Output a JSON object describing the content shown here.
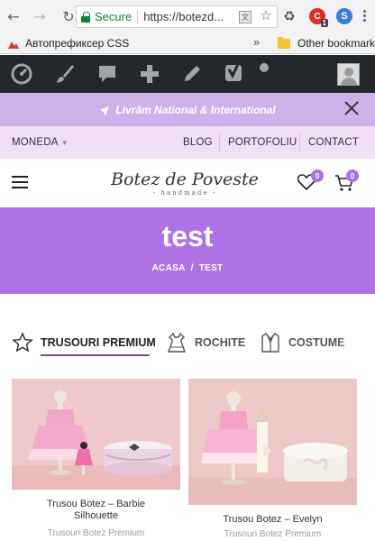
{
  "browser": {
    "secure_label": "Secure",
    "url": "https://botezd...",
    "bookmark_1": "Автопрефиксер CSS",
    "bookmark_more": "»",
    "other_bookmarks": "Other bookmarks",
    "extension_badge": "1"
  },
  "promo": {
    "text": "Livrăm National & International"
  },
  "topnav": {
    "currency": "MONEDA",
    "links": [
      "BLOG",
      "PORTOFOLIU",
      "CONTACT"
    ]
  },
  "header": {
    "logo_main": "Botez de Poveste",
    "logo_sub": "- handmade -",
    "wishlist_count": "0",
    "cart_count": "0"
  },
  "page": {
    "title": "test",
    "breadcrumb": [
      "ACASA",
      "/",
      "TEST"
    ]
  },
  "categories": [
    {
      "label": "TRUSOURI PREMIUM",
      "icon": "star-icon",
      "active": true
    },
    {
      "label": "ROCHITE",
      "icon": "dress-icon",
      "active": false
    },
    {
      "label": "COSTUME",
      "icon": "suit-icon",
      "active": false
    }
  ],
  "products": [
    {
      "title": "Trusou Botez – Barbie Silhouette",
      "category": "Trusouri Botez Premium"
    },
    {
      "title": "Trusou Botez – Evelyn",
      "category": "Trusouri Botez Premium"
    }
  ],
  "colors": {
    "admin_bar": "#23282d",
    "promo_bar": "#cdb2ea",
    "top_nav": "#f1dff6",
    "title_band": "#b073e6",
    "badge": "#b06ee3",
    "product_bg": "#efc9c9"
  }
}
